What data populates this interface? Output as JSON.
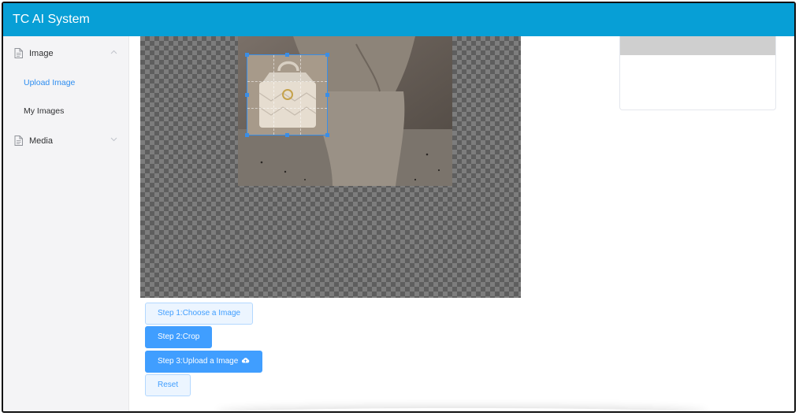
{
  "app": {
    "title": "TC AI System"
  },
  "sidebar": {
    "menus": [
      {
        "label": "Image",
        "icon": "document-icon",
        "expanded": true,
        "children": [
          {
            "label": "Upload Image",
            "active": true
          },
          {
            "label": "My Images",
            "active": false
          }
        ]
      },
      {
        "label": "Media",
        "icon": "document-icon",
        "expanded": false
      }
    ]
  },
  "buttons": {
    "choose": "Step 1:Choose a Image",
    "crop": "Step 2:Crop",
    "upload": "Step 3:Upload a Image",
    "reset": "Reset"
  },
  "colors": {
    "header": "#079fd6",
    "accent": "#409eff",
    "sidebar_bg": "#f4f4f6",
    "plain_button_bg": "#ecf5ff"
  },
  "icons": {
    "upload": "cloud-upload-icon",
    "expand": "chevron-down-icon",
    "collapse": "chevron-up-icon"
  }
}
